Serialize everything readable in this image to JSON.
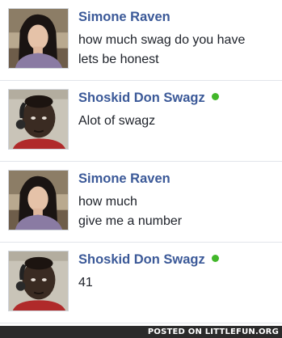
{
  "messages": [
    {
      "sender": "Simone Raven",
      "online": false,
      "avatar": "female-avatar",
      "lines": [
        "how much swag do you have",
        "lets be honest"
      ]
    },
    {
      "sender": "Shoskid Don Swagz",
      "online": true,
      "avatar": "male-avatar",
      "lines": [
        "Alot of swagz"
      ]
    },
    {
      "sender": "Simone Raven",
      "online": false,
      "avatar": "female-avatar",
      "lines": [
        "how much",
        "give me a number"
      ]
    },
    {
      "sender": "Shoskid Don Swagz",
      "online": true,
      "avatar": "male-avatar",
      "lines": [
        "41"
      ]
    }
  ],
  "colors": {
    "name": "#3b5998",
    "online": "#42b72a",
    "text": "#1d2129"
  },
  "footer": {
    "text": "POSTED ON LITTLEFUN.ORG"
  }
}
